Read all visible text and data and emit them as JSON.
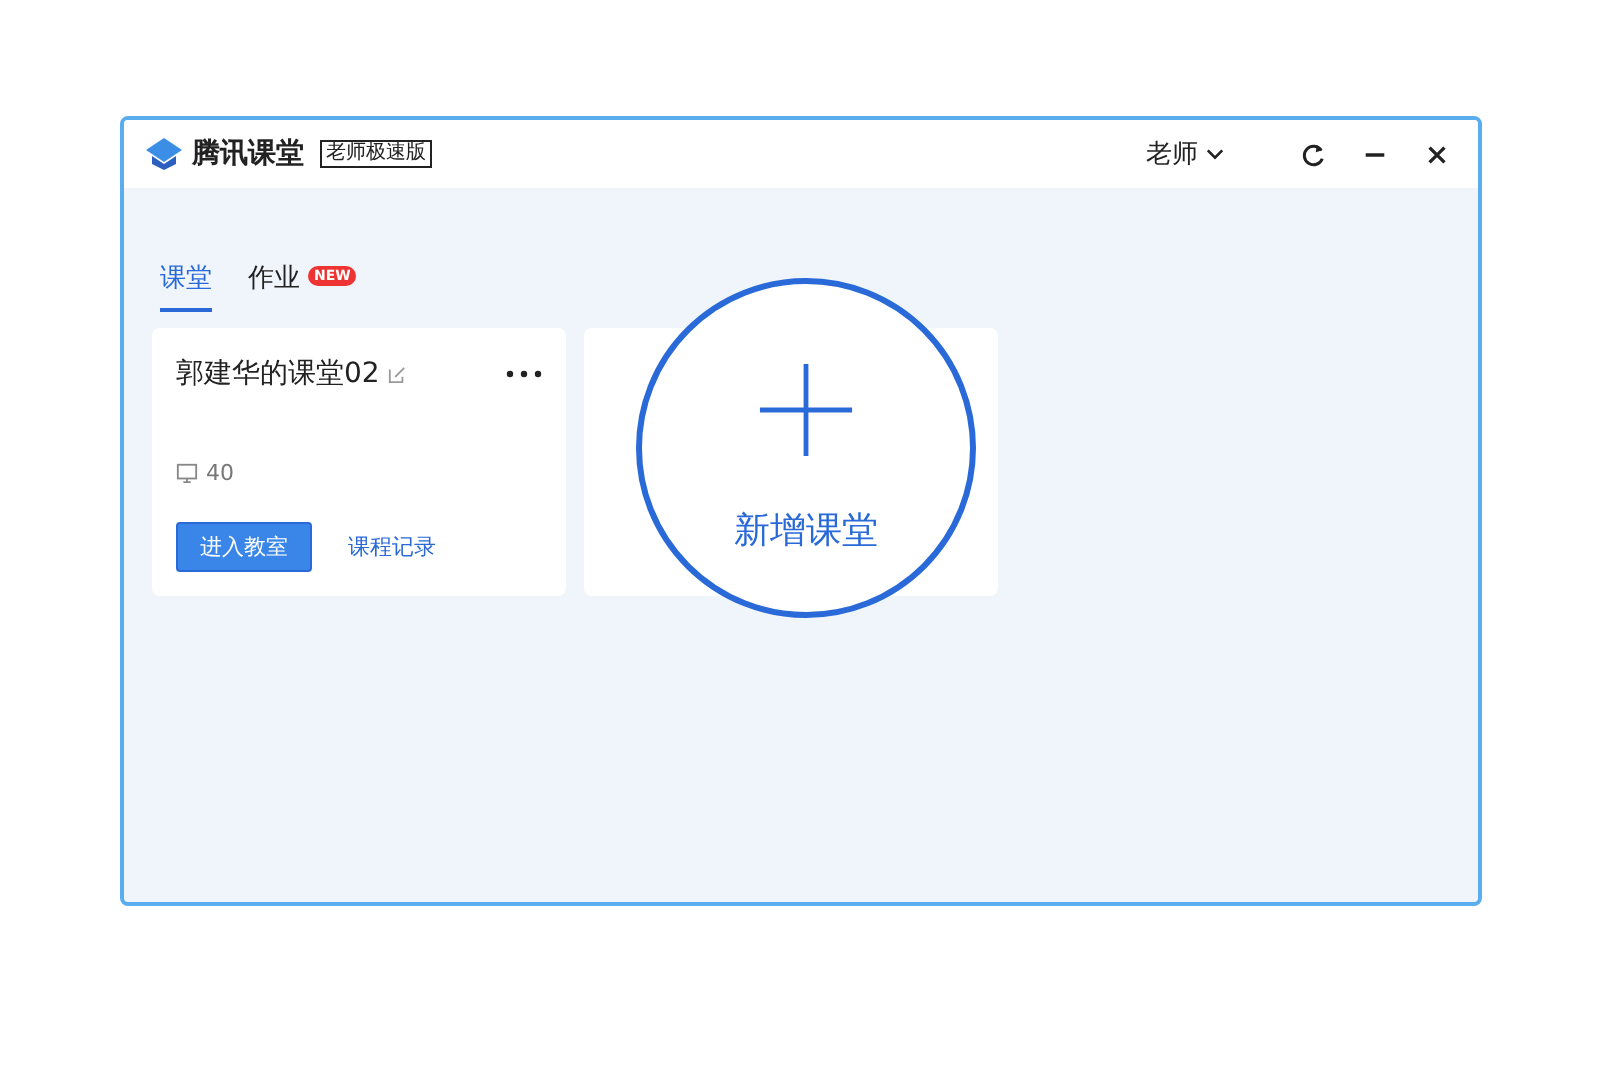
{
  "window": {
    "app_name": "腾讯课堂",
    "edition_badge": "老师极速版",
    "user_menu": "老师"
  },
  "tabs": [
    {
      "label": "课堂",
      "selected": true
    },
    {
      "label": "作业",
      "selected": false,
      "badge": "NEW"
    }
  ],
  "classes": [
    {
      "title": "郭建华的课堂02",
      "count": "40",
      "primary_action": "进入教室",
      "secondary_action": "课程记录"
    }
  ],
  "add_card": {
    "label": "新增课堂"
  }
}
